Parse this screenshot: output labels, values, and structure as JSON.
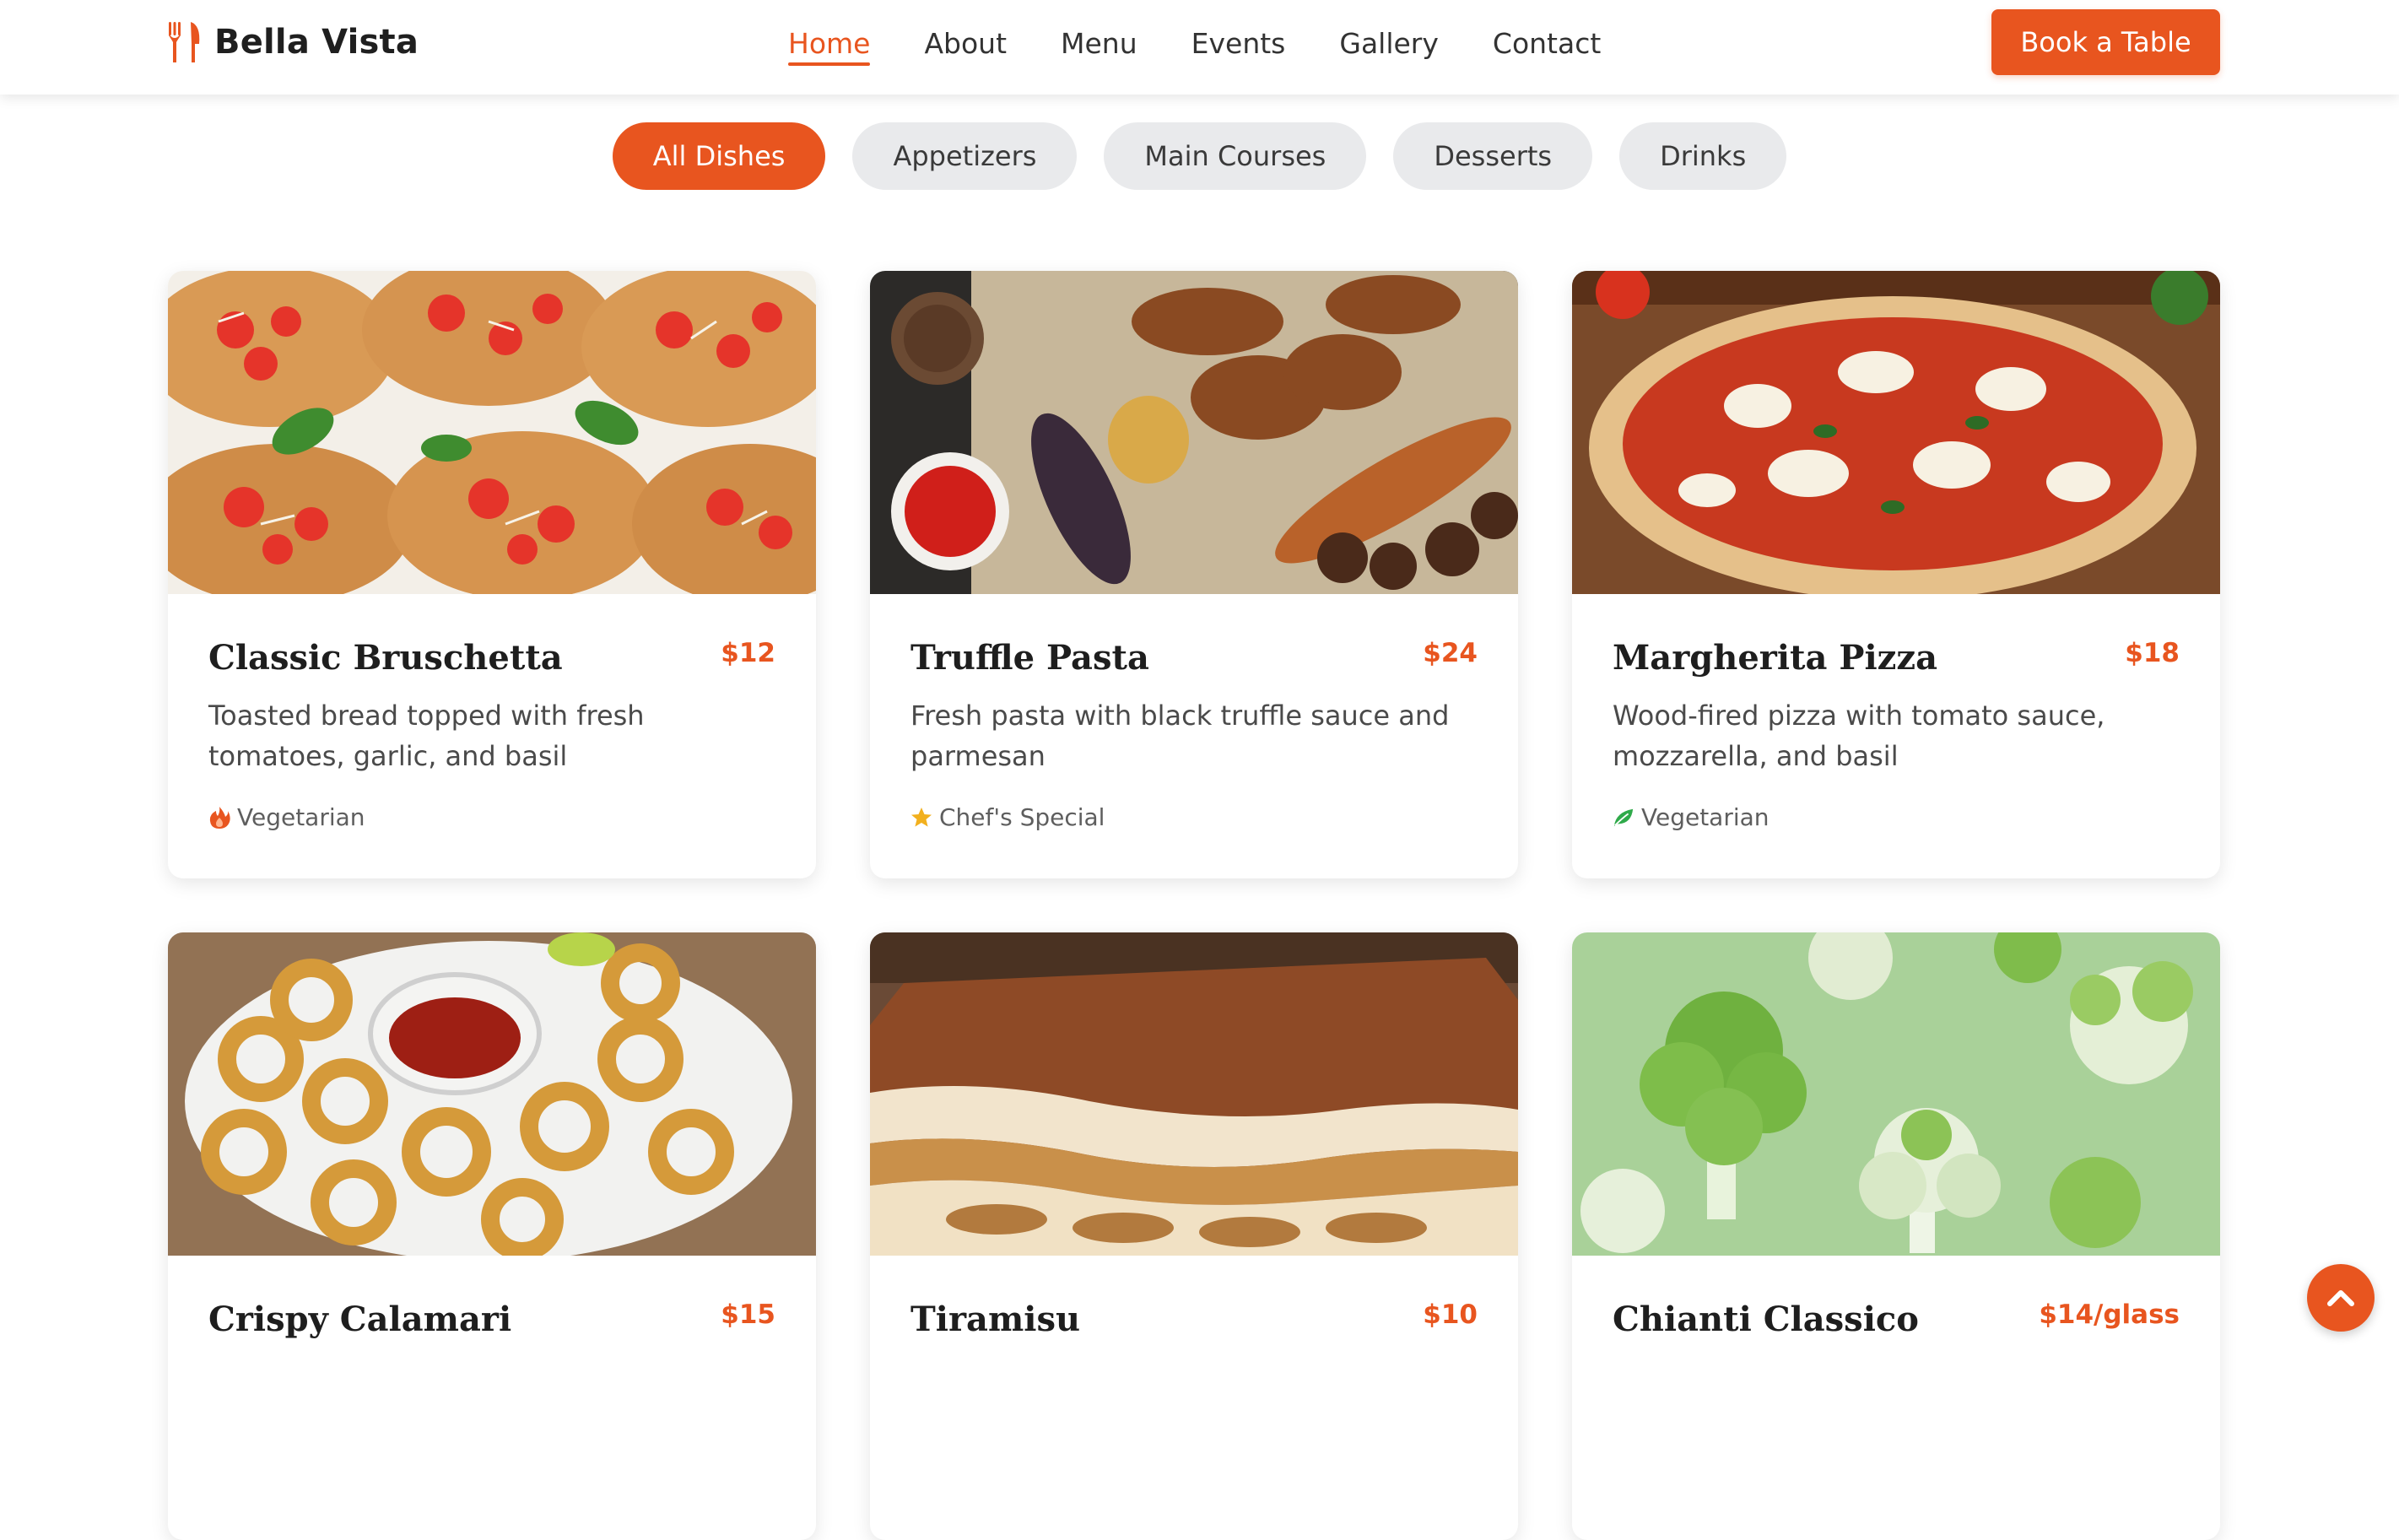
{
  "brand": {
    "name": "Bella Vista",
    "icon": "utensils-icon"
  },
  "nav": {
    "links": [
      {
        "label": "Home",
        "active": true
      },
      {
        "label": "About",
        "active": false
      },
      {
        "label": "Menu",
        "active": false
      },
      {
        "label": "Events",
        "active": false
      },
      {
        "label": "Gallery",
        "active": false
      },
      {
        "label": "Contact",
        "active": false
      }
    ],
    "cta_label": "Book a Table"
  },
  "filters": [
    {
      "label": "All Dishes",
      "active": true
    },
    {
      "label": "Appetizers",
      "active": false
    },
    {
      "label": "Main Courses",
      "active": false
    },
    {
      "label": "Desserts",
      "active": false
    },
    {
      "label": "Drinks",
      "active": false
    }
  ],
  "dishes": [
    {
      "title": "Classic Bruschetta",
      "price": "$12",
      "description": "Toasted bread topped with fresh tomatoes, garlic, and basil",
      "tag": "Vegetarian",
      "tag_icon": "fire-icon"
    },
    {
      "title": "Truffle Pasta",
      "price": "$24",
      "description": "Fresh pasta with black truffle sauce and parmesan",
      "tag": "Chef's Special",
      "tag_icon": "star-icon"
    },
    {
      "title": "Margherita Pizza",
      "price": "$18",
      "description": "Wood-fired pizza with tomato sauce, mozzarella, and basil",
      "tag": "Vegetarian",
      "tag_icon": "leaf-icon"
    },
    {
      "title": "Crispy Calamari",
      "price": "$15"
    },
    {
      "title": "Tiramisu",
      "price": "$10"
    },
    {
      "title": "Chianti Classico",
      "price": "$14/glass"
    }
  ],
  "colors": {
    "accent": "#e8551f",
    "pill_bg": "#e9eaec",
    "star": "#f2b01e",
    "leaf": "#2faa4a"
  },
  "scroll_top_icon": "chevron-up-icon"
}
